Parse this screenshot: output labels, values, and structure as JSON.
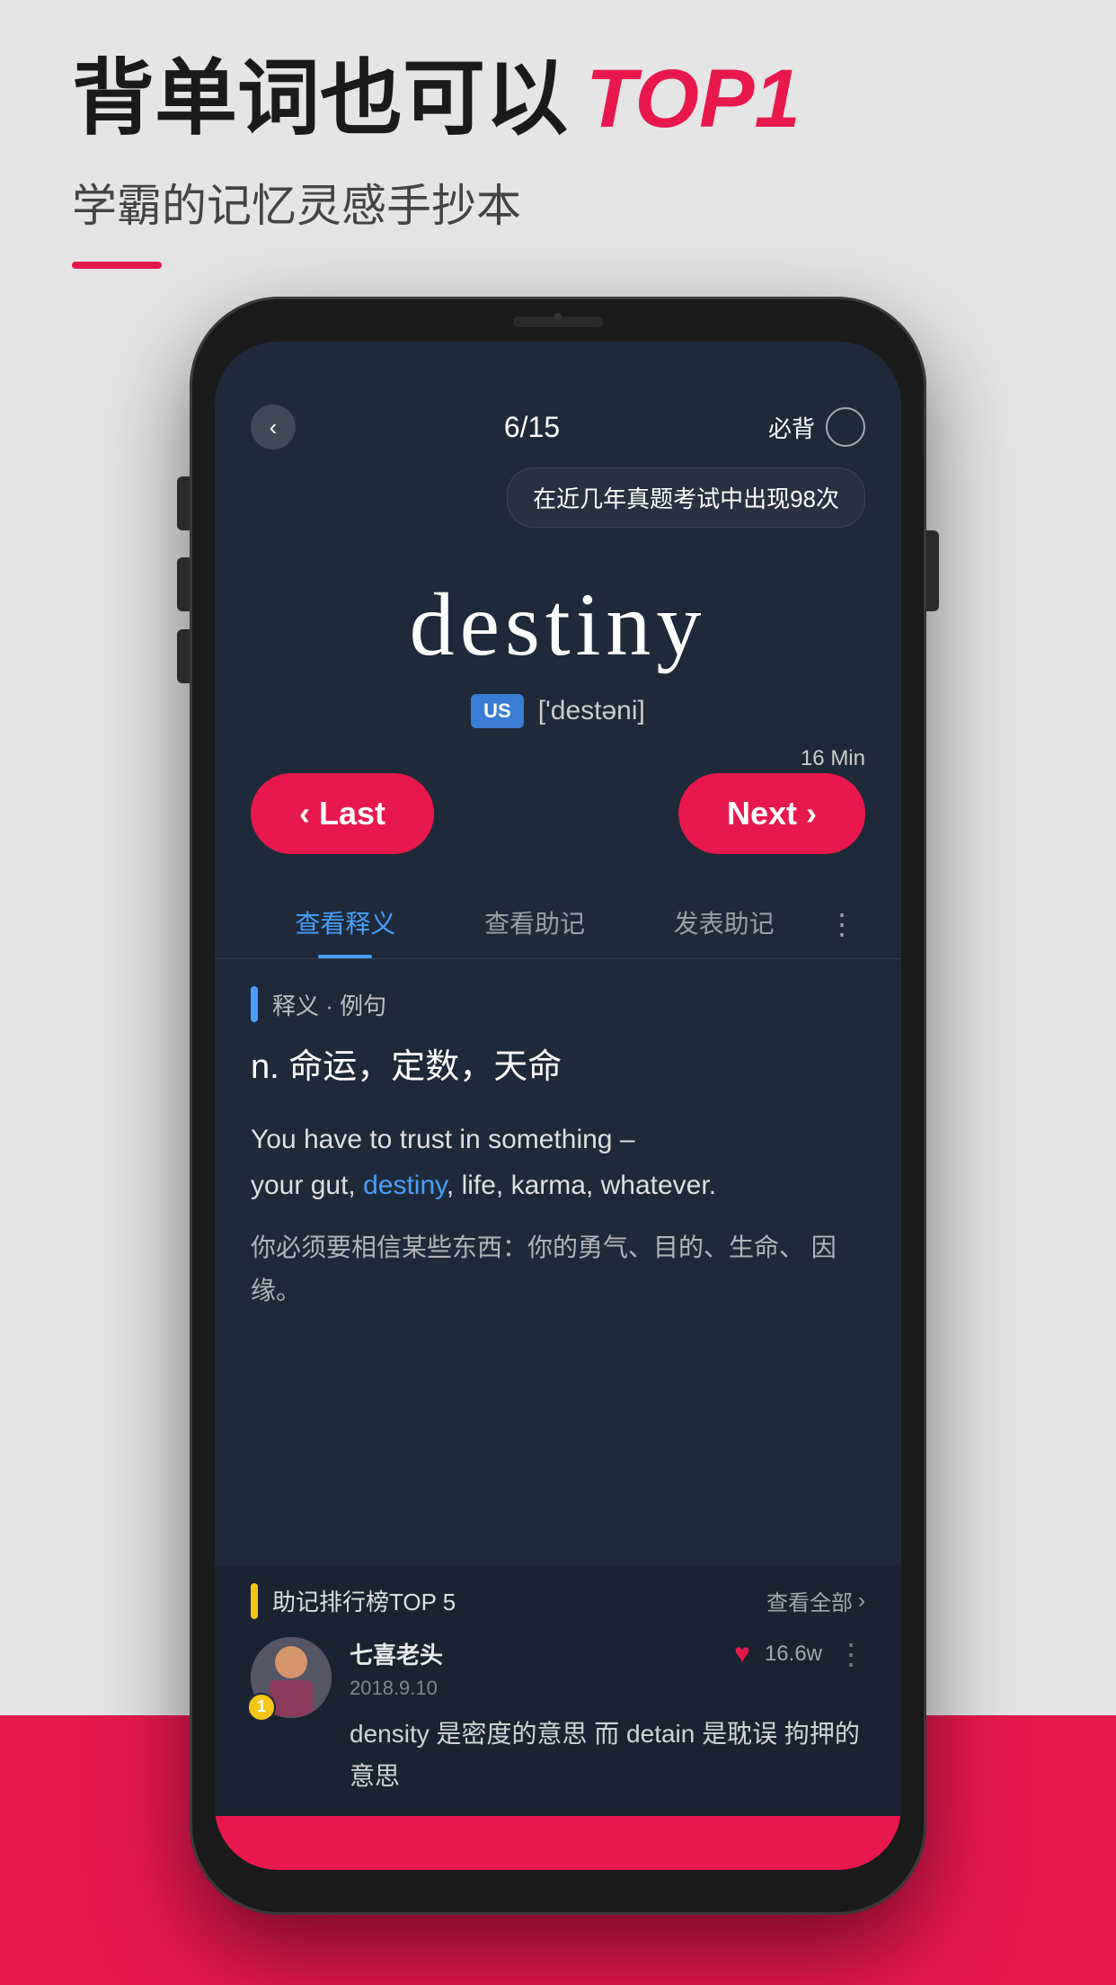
{
  "headline": {
    "part1": "背单词也可以",
    "top1": "TOP1",
    "subtitle": "学霸的记忆灵感手抄本"
  },
  "phone": {
    "header": {
      "back_label": "‹",
      "progress": "6/15",
      "must_label": "必背"
    },
    "tooltip": "在近几年真题考试中出现98次",
    "word": {
      "text": "destiny",
      "us_label": "US",
      "phonetic": "['destəni]"
    },
    "timer": "16 Min",
    "nav": {
      "last_label": "‹ Last",
      "next_label": "Next ›"
    },
    "tabs": [
      {
        "label": "查看释义",
        "active": true
      },
      {
        "label": "查看助记",
        "active": false
      },
      {
        "label": "发表助记",
        "active": false
      }
    ],
    "definition": {
      "section_label": "释义 · 例句",
      "def_text": "n.  命运，定数，天命",
      "example_en_parts": [
        {
          "text": "You have to trust in something –\nyour gut, ",
          "highlight": false
        },
        {
          "text": "destiny",
          "highlight": true
        },
        {
          "text": ", life, karma, whatever.",
          "highlight": false
        }
      ],
      "example_cn": "你必须要相信某些东西：你的勇气、目的、生命、\n因缘。"
    },
    "mnemonic": {
      "section_label": "助记排行榜TOP 5",
      "see_all": "查看全部",
      "user": {
        "name": "七喜老头",
        "date": "2018.9.10",
        "rank": "1",
        "like_count": "16.6w",
        "content": "density 是密度的意思 而 detain 是耽误\n拘押的意思"
      }
    }
  }
}
